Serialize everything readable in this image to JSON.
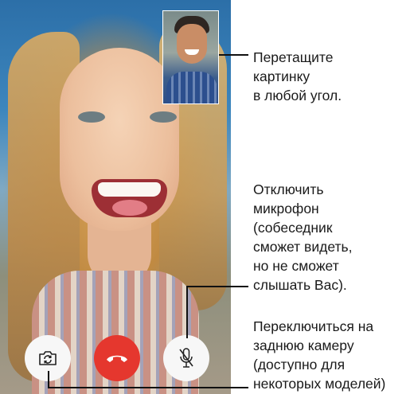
{
  "callouts": {
    "drag_picture": "Перетащите\nкартинку\nв любой угол.",
    "mute": "Отключить\nмикрофон\n(собеседник\nсможет видеть,\nно не сможет\nслышать Вас).",
    "switch_camera": "Переключиться на\nзаднюю камеру\n(доступно для\nнекоторых моделей)"
  },
  "controls": [
    {
      "name": "switch-camera-button",
      "icon": "camera-flip-icon",
      "color": "#f7f7f7"
    },
    {
      "name": "end-call-button",
      "icon": "phone-hangup-icon",
      "color": "#e5372e"
    },
    {
      "name": "mute-button",
      "icon": "microphone-muted-icon",
      "color": "#f7f7f7"
    }
  ],
  "colors": {
    "end_call_red": "#e5372e",
    "button_white": "#f7f7f7",
    "callout_line": "#111111"
  }
}
